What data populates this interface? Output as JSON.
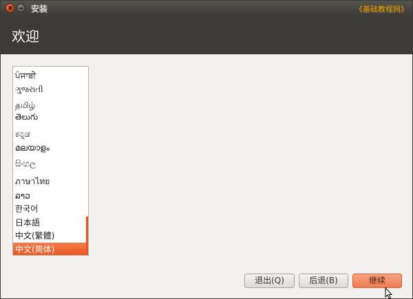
{
  "window": {
    "title": "安装",
    "watermark": "《基础教程网》"
  },
  "header": {
    "title": "欢迎"
  },
  "languages": {
    "items": [
      {
        "label": "ਪੰਜਾਬੀ",
        "selected": false
      },
      {
        "label": "ગુજરાતી",
        "selected": false
      },
      {
        "label": "தமிழ்",
        "selected": false
      },
      {
        "label": "తెలుగు",
        "selected": false
      },
      {
        "label": "ಕನ್ನಡ",
        "selected": false
      },
      {
        "label": "മലയാളം",
        "selected": false
      },
      {
        "label": "සිංහල",
        "selected": false
      },
      {
        "label": "ภาษาไทย",
        "selected": false
      },
      {
        "label": "ລາວ",
        "selected": false
      },
      {
        "label": "한국어",
        "selected": false
      },
      {
        "label": "日本語",
        "selected": false
      },
      {
        "label": "中文(繁體)",
        "selected": false
      },
      {
        "label": "中文(简体)",
        "selected": true
      }
    ]
  },
  "buttons": {
    "quit_label": "退出(Q)",
    "back_label": "后退(B)",
    "continue_label": "继续"
  },
  "colors": {
    "accent": "#e9541e",
    "header_bg": "#3c3b37",
    "window_bg": "#f2f1ef"
  },
  "icons": {
    "close": "close-icon",
    "minimize": "minimize-icon",
    "cursor": "mouse-pointer-icon"
  }
}
